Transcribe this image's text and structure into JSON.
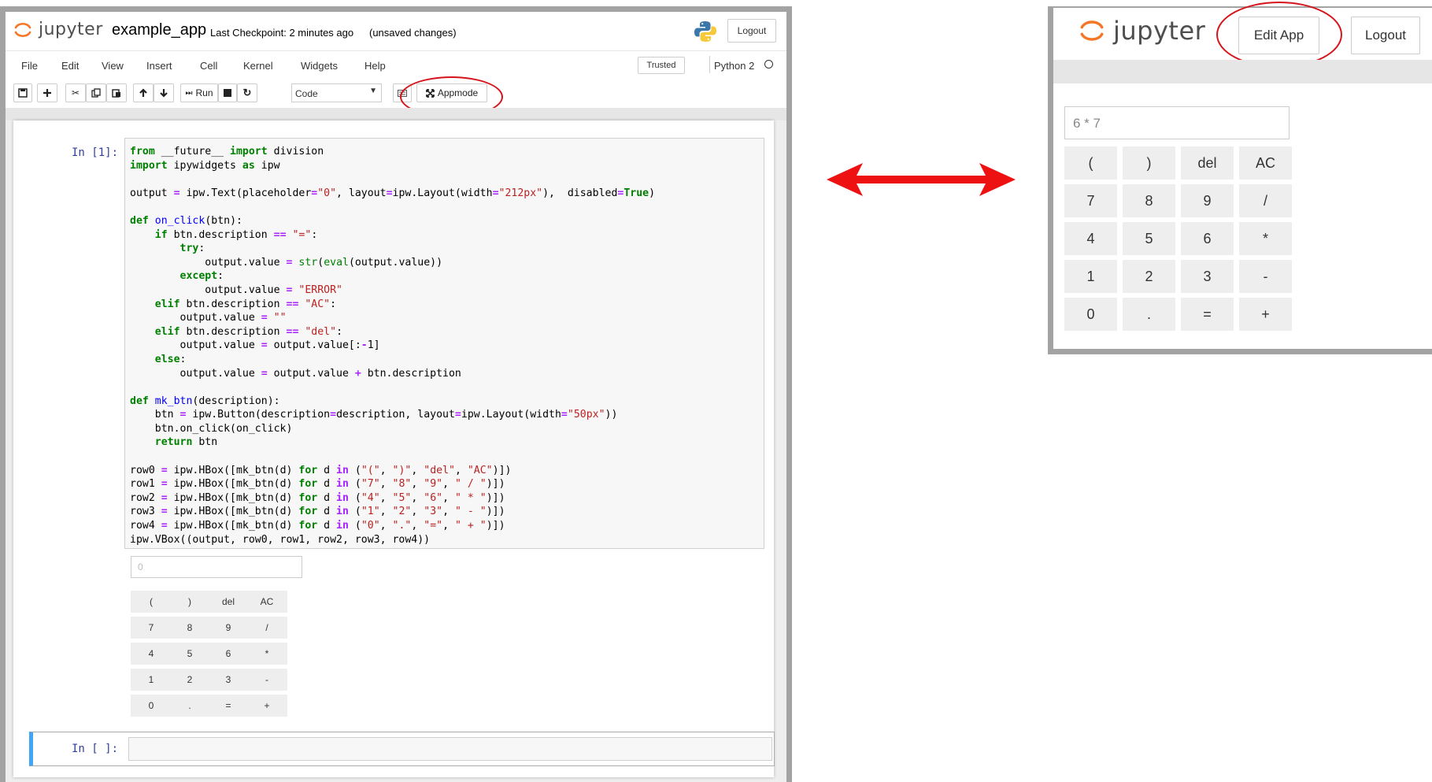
{
  "notebook": {
    "logo_text": "jupyter",
    "title": "example_app",
    "checkpoint": "Last Checkpoint: 2 minutes ago",
    "status": "(unsaved changes)",
    "logout_label": "Logout",
    "menu": [
      "File",
      "Edit",
      "View",
      "Insert",
      "Cell",
      "Kernel",
      "Widgets",
      "Help"
    ],
    "trusted_label": "Trusted",
    "kernel_name": "Python 2",
    "toolbar": {
      "run_label": "Run",
      "cell_type": "Code",
      "appmode_label": "Appmode"
    },
    "cell1_prompt": "In [1]:",
    "cell2_prompt": "In [ ]:",
    "widget": {
      "output_placeholder": "0",
      "buttons": [
        [
          "(",
          ")",
          "del",
          "AC"
        ],
        [
          "7",
          "8",
          "9",
          "/"
        ],
        [
          "4",
          "5",
          "6",
          "*"
        ],
        [
          "1",
          "2",
          "3",
          "-"
        ],
        [
          "0",
          ".",
          "=",
          "+"
        ]
      ]
    }
  },
  "app": {
    "logo_text": "jupyter",
    "edit_app_label": "Edit App",
    "logout_label": "Logout",
    "output_value": "6 * 7",
    "buttons": [
      [
        "(",
        ")",
        "del",
        "AC"
      ],
      [
        "7",
        "8",
        "9",
        "/"
      ],
      [
        "4",
        "5",
        "6",
        "*"
      ],
      [
        "1",
        "2",
        "3",
        "-"
      ],
      [
        "0",
        ".",
        "=",
        "+"
      ]
    ]
  },
  "colors": {
    "annotation_red": "#d4151b",
    "arrow_red": "#ee1111",
    "prompt_blue": "#303f9f",
    "jupyter_orange": "#f37726",
    "selected_cell_blue": "#42a5f5"
  },
  "icons": [
    "jupyter-logo-icon",
    "python-logo-icon",
    "save-icon",
    "plus-icon",
    "cut-icon",
    "copy-icon",
    "paste-icon",
    "arrow-up-icon",
    "arrow-down-icon",
    "step-forward-icon",
    "stop-icon",
    "refresh-icon",
    "keyboard-icon",
    "expand-icon",
    "double-headed-arrow-icon"
  ]
}
